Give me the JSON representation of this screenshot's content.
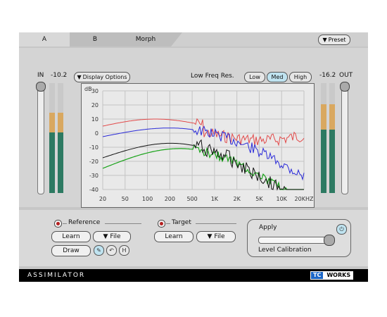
{
  "tabs": [
    {
      "label": "A"
    },
    {
      "label": "B"
    },
    {
      "label": "Morph"
    }
  ],
  "preset": {
    "label": "Preset",
    "icon": "triangle-down-icon"
  },
  "in_label": "IN",
  "out_label": "OUT",
  "in_value": "-10.2",
  "out_value": "-16.2",
  "display_options": {
    "label": "Display Options",
    "icon": "triangle-down-icon"
  },
  "low_freq": {
    "label": "Low Freq Res.",
    "options": [
      "Low",
      "Med",
      "High"
    ],
    "selected": "Med"
  },
  "graph": {
    "y_unit": "dB",
    "y_ticks": [
      "30",
      "20",
      "10",
      "0",
      "-10",
      "-20",
      "-30",
      "-40"
    ],
    "x_ticks": [
      "20",
      "50",
      "100",
      "200",
      "500",
      "1K",
      "2K",
      "5K",
      "10K",
      "20KHZ"
    ]
  },
  "reference": {
    "label": "Reference",
    "learn": "Learn",
    "file": "File",
    "draw": "Draw"
  },
  "target": {
    "label": "Target",
    "learn": "Learn",
    "file": "File"
  },
  "apply": {
    "label": "Apply",
    "calibration": "Level Calibration"
  },
  "footer": {
    "brand": "ASSIMILATOR",
    "logo_tc": "TC",
    "logo_works": "WORKS"
  },
  "colors": {
    "accent": "#1c67c8",
    "meter_green": "#2d7a62",
    "meter_orange": "#d9a860",
    "curve_red": "#e24a4a",
    "curve_blue": "#2a2ad8",
    "curve_green": "#1aa31a",
    "curve_black": "#111111"
  }
}
